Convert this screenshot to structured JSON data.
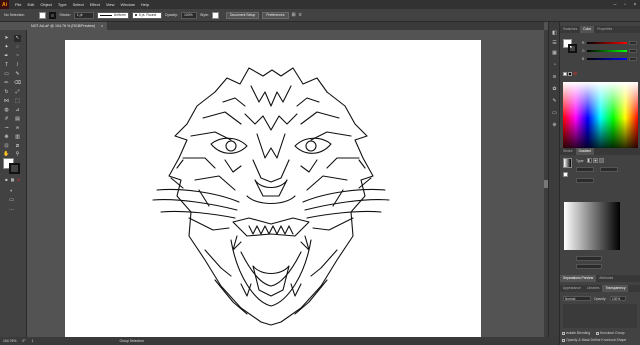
{
  "menubar": {
    "logo": "Ai",
    "items": [
      "File",
      "Edit",
      "Object",
      "Type",
      "Select",
      "Effect",
      "View",
      "Window",
      "Help"
    ]
  },
  "controlbar": {
    "selection": "No Selection",
    "stroke_label": "Stroke:",
    "stroke_value": "1 pt",
    "profile": "Uniform",
    "brush": "5 pt. Round",
    "opacity_label": "Opacity:",
    "opacity_value": "100%",
    "style_label": "Style:",
    "doc_setup": "Document Setup",
    "preferences": "Preferences"
  },
  "document": {
    "tab_title": "NOT AA.ai* @ 104.76 % (RGB/Preview)",
    "close": "×"
  },
  "statusbar": {
    "zoom": "104.76%",
    "rotation": "0°",
    "artboard": "1",
    "tool": "Group Selection"
  },
  "panels": {
    "top_tabs": [
      "Swatches",
      "Color",
      "Properties"
    ],
    "mid_tabs": [
      "Stroke",
      "Gradient"
    ],
    "gradient_type_label": "Type:",
    "bottom_tabs": [
      "Separations Preview",
      "Attributes"
    ],
    "trans_tabs": [
      "Appearance",
      "Libraries",
      "Transparency"
    ],
    "blend_mode": "Normal",
    "opacity_label": "Opacity:",
    "opacity_value": "100%",
    "isolate_blending": "Isolate Blending",
    "knockout_group": "Knockout Group",
    "opacity_mask": "Opacity & Mask Define Knockout Shape",
    "slider_labels": [
      "R",
      "G",
      "B"
    ]
  },
  "colors": {
    "accent": "#2d8ceb",
    "ui_dark": "#323232",
    "ui_mid": "#424242",
    "canvas_bg": "#535353",
    "artboard": "#ffffff"
  }
}
